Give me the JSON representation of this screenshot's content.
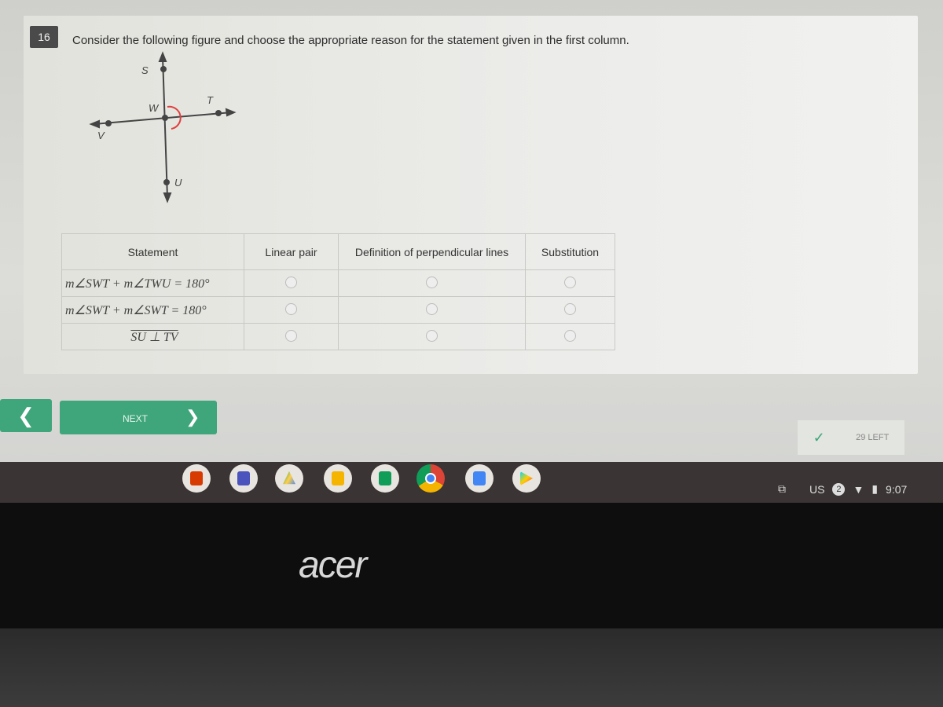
{
  "question": {
    "number": "16",
    "text": "Consider the following figure and choose the appropriate reason for the statement given in the first column."
  },
  "figure": {
    "labels": {
      "S": "S",
      "T": "T",
      "W": "W",
      "V": "V",
      "U": "U"
    },
    "angle_color": "#e04040"
  },
  "table": {
    "headers": [
      "Statement",
      "Linear pair",
      "Definition of perpendicular lines",
      "Substitution"
    ],
    "rows": [
      {
        "statement": "m∠SWT + m∠TWU = 180°"
      },
      {
        "statement": "m∠SWT + m∠SWT = 180°"
      },
      {
        "statement": "SU ⊥ TV"
      }
    ]
  },
  "nav": {
    "back_icon": "chevron-left-icon",
    "next_label": "NEXT",
    "next_icon": "chevron-right-icon",
    "accent": "#3fa57a"
  },
  "progress": {
    "remaining": "29 LEFT",
    "check_icon": "check-icon"
  },
  "shelf": {
    "apps": [
      "office",
      "teams",
      "drive",
      "slides",
      "sheets",
      "chrome",
      "docs",
      "play-store"
    ]
  },
  "tray": {
    "keyboard": "US",
    "notifications": "2",
    "time": "9:07"
  },
  "device": {
    "brand": "acer"
  }
}
